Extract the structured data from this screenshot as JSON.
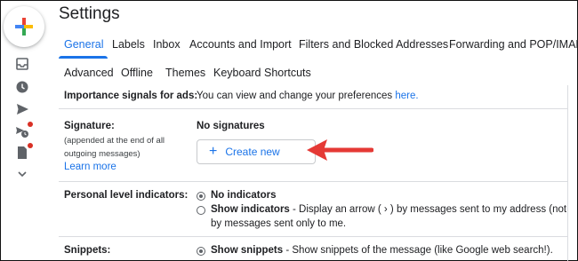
{
  "header": {
    "title": "Settings"
  },
  "tabs": [
    {
      "label": "General",
      "active": true
    },
    {
      "label": "Labels"
    },
    {
      "label": "Inbox"
    },
    {
      "label": "Accounts and Import"
    },
    {
      "label": "Filters and Blocked Addresses"
    },
    {
      "label": "Forwarding and POP/IMAP"
    }
  ],
  "tabs_row2": [
    {
      "label": "Advanced"
    },
    {
      "label": "Offline"
    },
    {
      "label": "Themes"
    },
    {
      "label": "Keyboard Shortcuts"
    }
  ],
  "importance": {
    "label": "Importance signals for ads:",
    "text": "You can view and change your preferences ",
    "link": "here."
  },
  "signature": {
    "label": "Signature:",
    "note_line1": "(appended at the end of all",
    "note_line2": "outgoing messages)",
    "learn_more": "Learn more",
    "status": "No signatures",
    "create_label": "Create new",
    "create_icon": "+"
  },
  "indicators": {
    "label": "Personal level indicators:",
    "option1": "No indicators",
    "option2_bold": "Show indicators",
    "option2_text": " - Display an arrow ( › ) by messages sent to my address (not a mai",
    "option2_line2": "by messages sent only to me."
  },
  "snippets": {
    "label": "Snippets:",
    "option1_bold": "Show snippets",
    "option1_text": " - Show snippets of the message (like Google web search!)."
  },
  "colors": {
    "accent": "#1a73e8",
    "arrow": "#e53935",
    "notification": "#d93025"
  },
  "icons": [
    "compose-plus-icon",
    "inbox-icon",
    "clock-icon",
    "send-icon",
    "scheduled-icon",
    "draft-icon",
    "chevron-down-icon"
  ]
}
